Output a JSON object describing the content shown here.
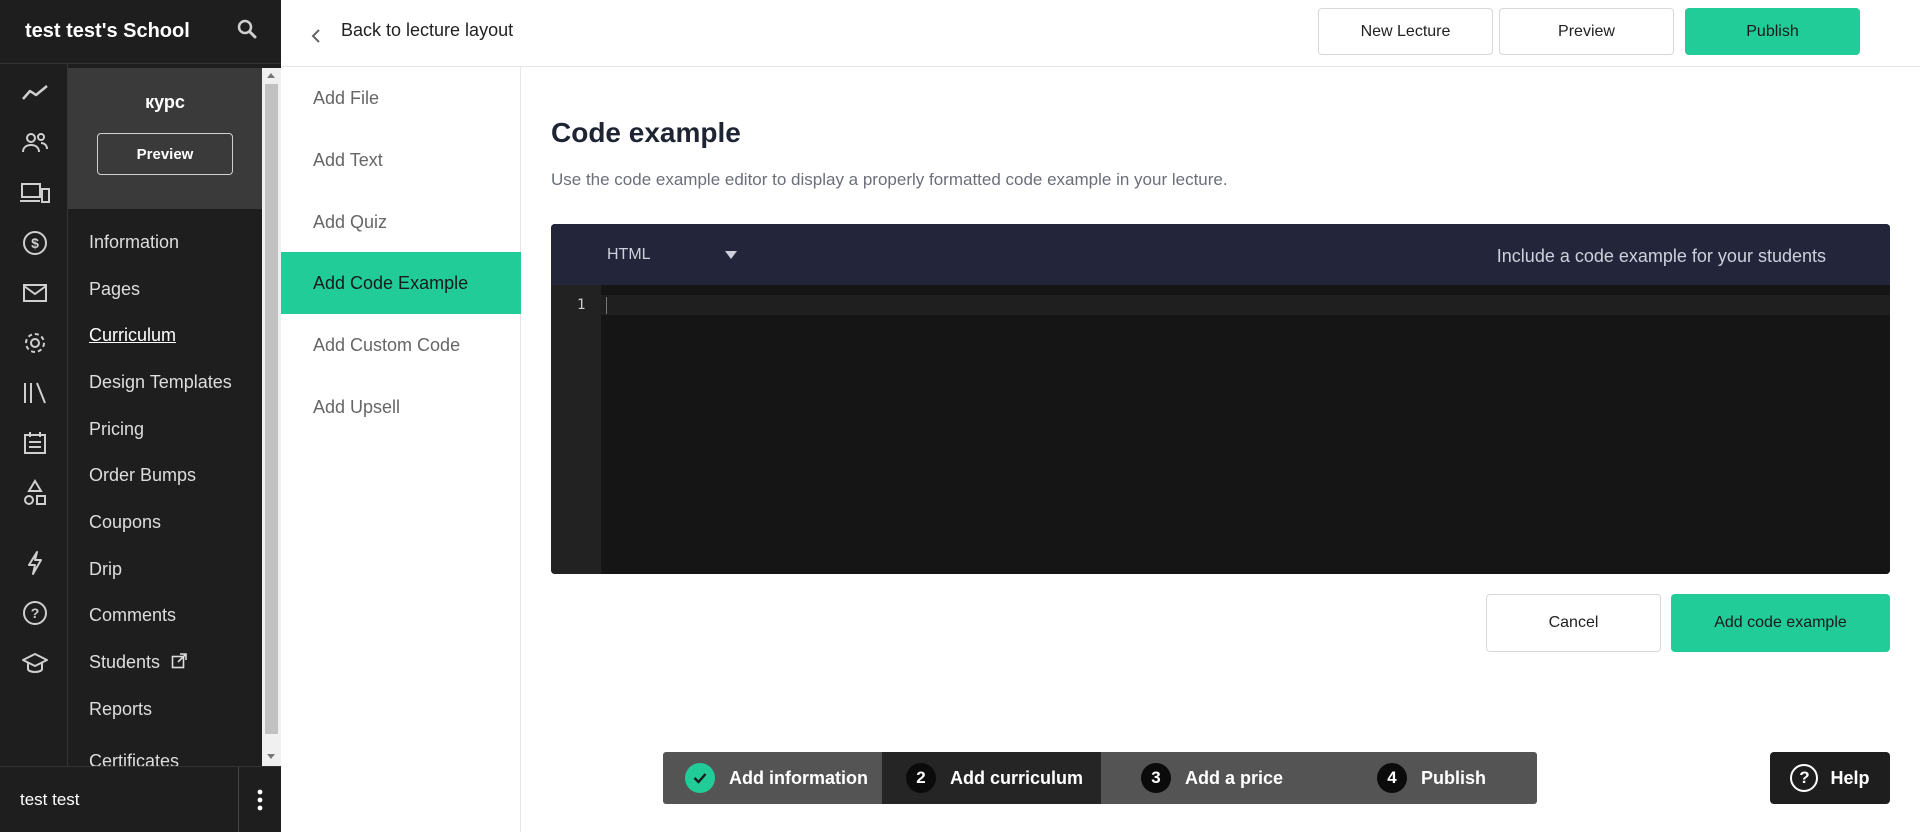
{
  "sidebar": {
    "school_name": "test test's School",
    "course": {
      "title": "курс",
      "preview_label": "Preview"
    },
    "items": [
      {
        "label": "Information"
      },
      {
        "label": "Pages"
      },
      {
        "label": "Curriculum"
      },
      {
        "label": "Design Templates"
      },
      {
        "label": "Pricing"
      },
      {
        "label": "Order Bumps"
      },
      {
        "label": "Coupons"
      },
      {
        "label": "Drip"
      },
      {
        "label": "Comments"
      },
      {
        "label": "Students"
      },
      {
        "label": "Reports"
      },
      {
        "label": "Certificates"
      }
    ],
    "active_item": "Curriculum",
    "user_name": "test test"
  },
  "header": {
    "back_label": "Back to lecture layout",
    "new_lecture_label": "New Lecture",
    "preview_label": "Preview",
    "publish_label": "Publish"
  },
  "content_nav": {
    "items": [
      {
        "label": "Add File"
      },
      {
        "label": "Add Text"
      },
      {
        "label": "Add Quiz"
      },
      {
        "label": "Add Code Example"
      },
      {
        "label": "Add Custom Code"
      },
      {
        "label": "Add Upsell"
      }
    ],
    "active_item": "Add Code Example"
  },
  "main": {
    "title": "Code example",
    "description": "Use the code example editor to display a properly formatted code example in your lecture.",
    "editor": {
      "language": "HTML",
      "hint": "Include a code example for your students",
      "line_number": "1",
      "code": ""
    },
    "cancel_label": "Cancel",
    "add_label": "Add code example"
  },
  "stepper": {
    "steps": [
      {
        "number": "",
        "label": "Add information",
        "status": "done"
      },
      {
        "number": "2",
        "label": "Add curriculum",
        "status": "current"
      },
      {
        "number": "3",
        "label": "Add a price",
        "status": "pending"
      },
      {
        "number": "4",
        "label": "Publish",
        "status": "pending"
      }
    ]
  },
  "help_label": "Help",
  "colors": {
    "accent": "#21cc98",
    "sidebar_bg": "#1e1e1e",
    "editor_header": "#23253a",
    "editor_bg": "#151515"
  }
}
